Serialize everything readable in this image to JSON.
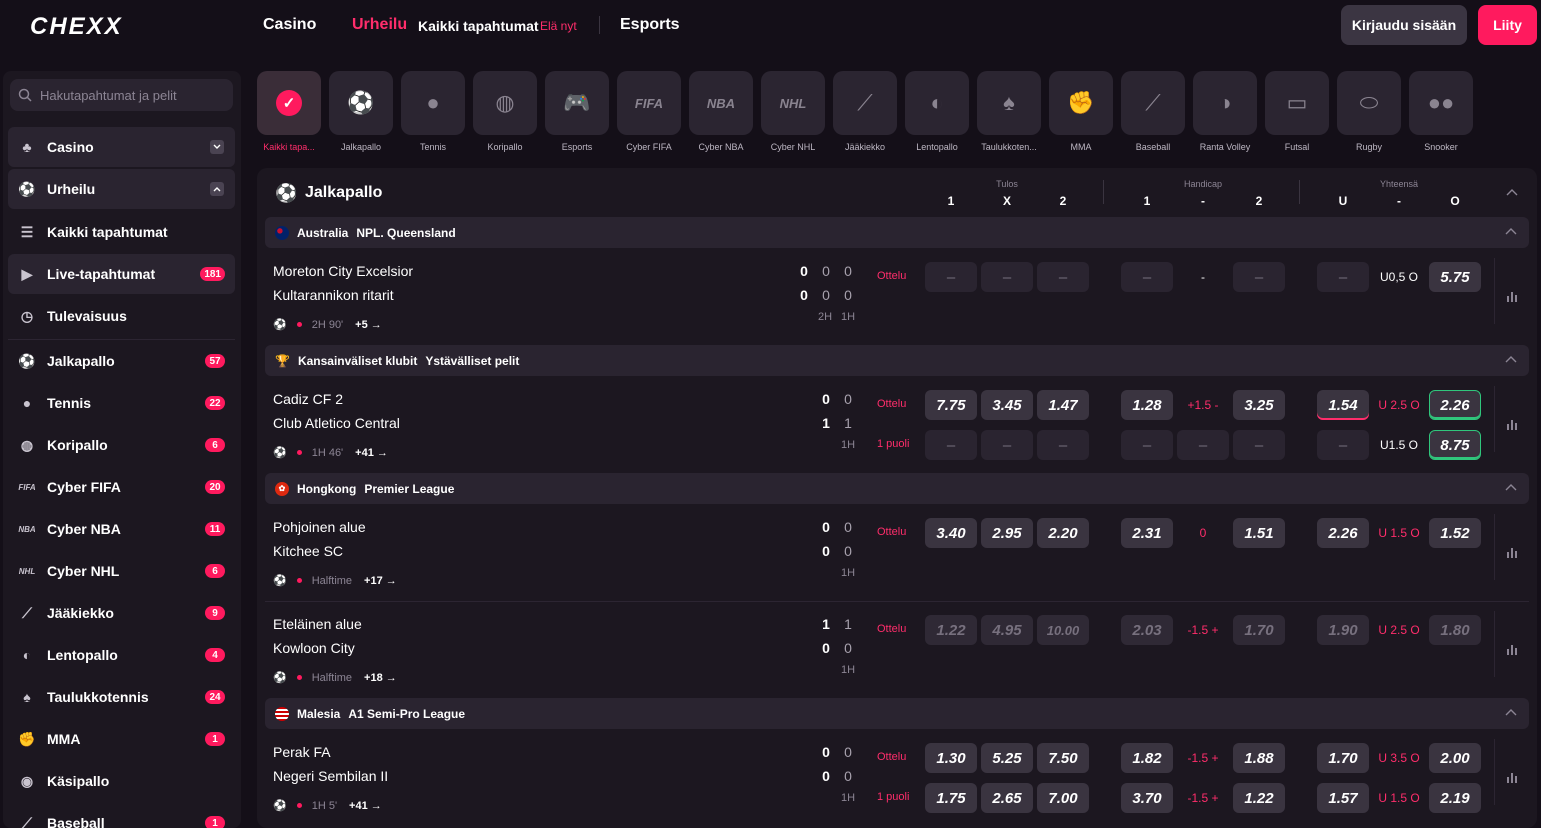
{
  "header": {
    "logo": "CHEXX",
    "nav": {
      "casino": "Casino",
      "sports": "Urheilu",
      "all_events": "Kaikki tapahtumat",
      "live": "Elä nyt",
      "esports": "Esports"
    },
    "login": "Kirjaudu sisään",
    "join": "Liity"
  },
  "sidebar": {
    "search_placeholder": "Hakutapahtumat ja pelit",
    "items": [
      {
        "label": "Casino",
        "icon": "casino-icon"
      },
      {
        "label": "Urheilu",
        "icon": "sports-icon"
      },
      {
        "label": "Kaikki tapahtumat",
        "icon": "list-icon"
      },
      {
        "label": "Live-tapahtumat",
        "icon": "play-icon",
        "count": "181"
      },
      {
        "label": "Tulevaisuus",
        "icon": "clock-icon"
      },
      {
        "label": "Jalkapallo",
        "icon": "football-icon",
        "count": "57"
      },
      {
        "label": "Tennis",
        "icon": "tennis-icon",
        "count": "22"
      },
      {
        "label": "Koripallo",
        "icon": "basketball-icon",
        "count": "6"
      },
      {
        "label": "Cyber FIFA",
        "icon": "fifa-icon",
        "count": "20"
      },
      {
        "label": "Cyber NBA",
        "icon": "nba-icon",
        "count": "11"
      },
      {
        "label": "Cyber NHL",
        "icon": "nhl-icon",
        "count": "6"
      },
      {
        "label": "Jääkiekko",
        "icon": "hockey-icon",
        "count": "9"
      },
      {
        "label": "Lentopallo",
        "icon": "volleyball-icon",
        "count": "4"
      },
      {
        "label": "Taulukkotennis",
        "icon": "table-tennis-icon",
        "count": "24"
      },
      {
        "label": "MMA",
        "icon": "mma-icon",
        "count": "1"
      },
      {
        "label": "Käsipallo",
        "icon": "handball-icon"
      },
      {
        "label": "Baseball",
        "icon": "baseball-icon",
        "count": "1"
      }
    ]
  },
  "sport_tabs": [
    {
      "label": "Kaikki tapa...",
      "icon": "check-icon"
    },
    {
      "label": "Jalkapallo",
      "icon": "football-icon"
    },
    {
      "label": "Tennis",
      "icon": "tennis-icon"
    },
    {
      "label": "Koripallo",
      "icon": "basketball-icon"
    },
    {
      "label": "Esports",
      "icon": "gamepad-icon"
    },
    {
      "label": "Cyber FIFA",
      "icon": "fifa-icon",
      "text": "FIFA"
    },
    {
      "label": "Cyber NBA",
      "icon": "nba-icon",
      "text": "NBA"
    },
    {
      "label": "Cyber NHL",
      "icon": "nhl-icon",
      "text": "NHL"
    },
    {
      "label": "Jääkiekko",
      "icon": "hockey-icon"
    },
    {
      "label": "Lentopallo",
      "icon": "volleyball-icon"
    },
    {
      "label": "Taulukkoten...",
      "icon": "table-tennis-icon"
    },
    {
      "label": "MMA",
      "icon": "mma-icon"
    },
    {
      "label": "Baseball",
      "icon": "baseball-icon"
    },
    {
      "label": "Ranta Volley",
      "icon": "beach-volley-icon"
    },
    {
      "label": "Futsal",
      "icon": "futsal-icon"
    },
    {
      "label": "Rugby",
      "icon": "rugby-icon"
    },
    {
      "label": "Snooker",
      "icon": "snooker-icon"
    }
  ],
  "section": {
    "title": "Jalkapallo",
    "groups": [
      {
        "name": "Tulos",
        "cols": [
          "1",
          "X",
          "2"
        ]
      },
      {
        "name": "Handicap",
        "cols": [
          "1",
          "-",
          "2"
        ]
      },
      {
        "name": "Yhteensä",
        "cols": [
          "U",
          "-",
          "O"
        ]
      }
    ]
  },
  "leagues": {
    "l1": {
      "country": "Australia",
      "name": "NPL. Queensland"
    },
    "l2": {
      "country": "Kansainväliset klubit",
      "name": "Ystävälliset pelit"
    },
    "l3": {
      "country": "Hongkong",
      "name": "Premier League"
    },
    "l4": {
      "country": "Malesia",
      "name": "A1 Semi-Pro League"
    }
  },
  "matches": {
    "m1": {
      "home": "Moreton City Excelsior",
      "away": "Kultarannikon ritarit",
      "s": [
        "0",
        "0",
        "0",
        "0",
        "0",
        "0"
      ],
      "periods": [
        "2H",
        "1H"
      ],
      "market": "Ottelu",
      "hcap": "-",
      "total": "U0,5 O",
      "odd_o": "5.75",
      "time": "2H 90'",
      "more": "+5 →"
    },
    "m2": {
      "home": "Cadiz CF 2",
      "away": "Club Atletico Central",
      "s": [
        "0",
        "0",
        "1",
        "1"
      ],
      "period": "1H",
      "market1": "Ottelu",
      "market2": "1 puoli",
      "odds1": [
        "7.75",
        "3.45",
        "1.47",
        "1.28",
        "3.25",
        "1.54",
        "2.26"
      ],
      "hcap1": "+1.5 -",
      "total1": "U 2.5 O",
      "total2": "U1.5 O",
      "odd_o2": "8.75",
      "time": "1H 46'",
      "more": "+41 →"
    },
    "m3": {
      "home": "Pohjoinen alue",
      "away": "Kitchee SC",
      "s": [
        "0",
        "0",
        "0",
        "0"
      ],
      "period": "1H",
      "market": "Ottelu",
      "odds": [
        "3.40",
        "2.95",
        "2.20",
        "2.31",
        "1.51",
        "2.26",
        "1.52"
      ],
      "hcap": "0",
      "total": "U 1.5 O",
      "time": "Halftime",
      "more": "+17 →"
    },
    "m4": {
      "home": "Eteläinen alue",
      "away": "Kowloon City",
      "s": [
        "1",
        "1",
        "0",
        "0"
      ],
      "period": "1H",
      "market": "Ottelu",
      "odds": [
        "1.22",
        "4.95",
        "10.00",
        "2.03",
        "1.70",
        "1.90",
        "1.80"
      ],
      "hcap": "-1.5 +",
      "total": "U 2.5 O",
      "time": "Halftime",
      "more": "+18 →"
    },
    "m5": {
      "home": "Perak FA",
      "away": "Negeri Sembilan II",
      "s": [
        "0",
        "0",
        "0",
        "0"
      ],
      "period": "1H",
      "market1": "Ottelu",
      "market2": "1 puoli",
      "odds1": [
        "1.30",
        "5.25",
        "7.50",
        "1.82",
        "1.88",
        "1.70",
        "2.00"
      ],
      "odds2": [
        "1.75",
        "2.65",
        "7.00",
        "3.70",
        "1.22",
        "1.57",
        "2.19"
      ],
      "hcap1": "-1.5 +",
      "hcap2": "-1.5 +",
      "total1": "U 3.5 O",
      "total2": "U 1.5 O",
      "time": "1H 5'",
      "more": "+41 →"
    }
  },
  "colors": {
    "accent": "#ff1a5e",
    "bg": "#140f18",
    "panel": "#1c1720",
    "up": "#30c67c"
  }
}
